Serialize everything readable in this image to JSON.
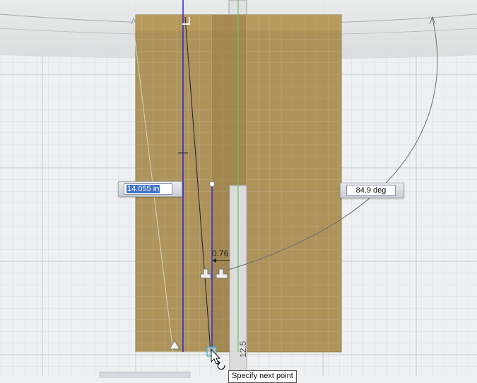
{
  "viewport": {
    "background": "#eef0f1",
    "grid_minor_color": "#d9dde1",
    "grid_major_color": "#c3c8ce"
  },
  "sketch": {
    "profile_fill": "#a88c4e",
    "profile_stroke": "#8f7640",
    "construction_line_color": "#3b2bd6",
    "axis_color": "#5fbf5f"
  },
  "dimensions": {
    "length_value": "14.055 in",
    "angle_value": "84.9 deg",
    "offset_label": "0.76",
    "vertical_label": "12.5"
  },
  "tooltip": {
    "text": "Specify next point"
  },
  "cursor": {
    "name": "pointer-with-rotate"
  }
}
